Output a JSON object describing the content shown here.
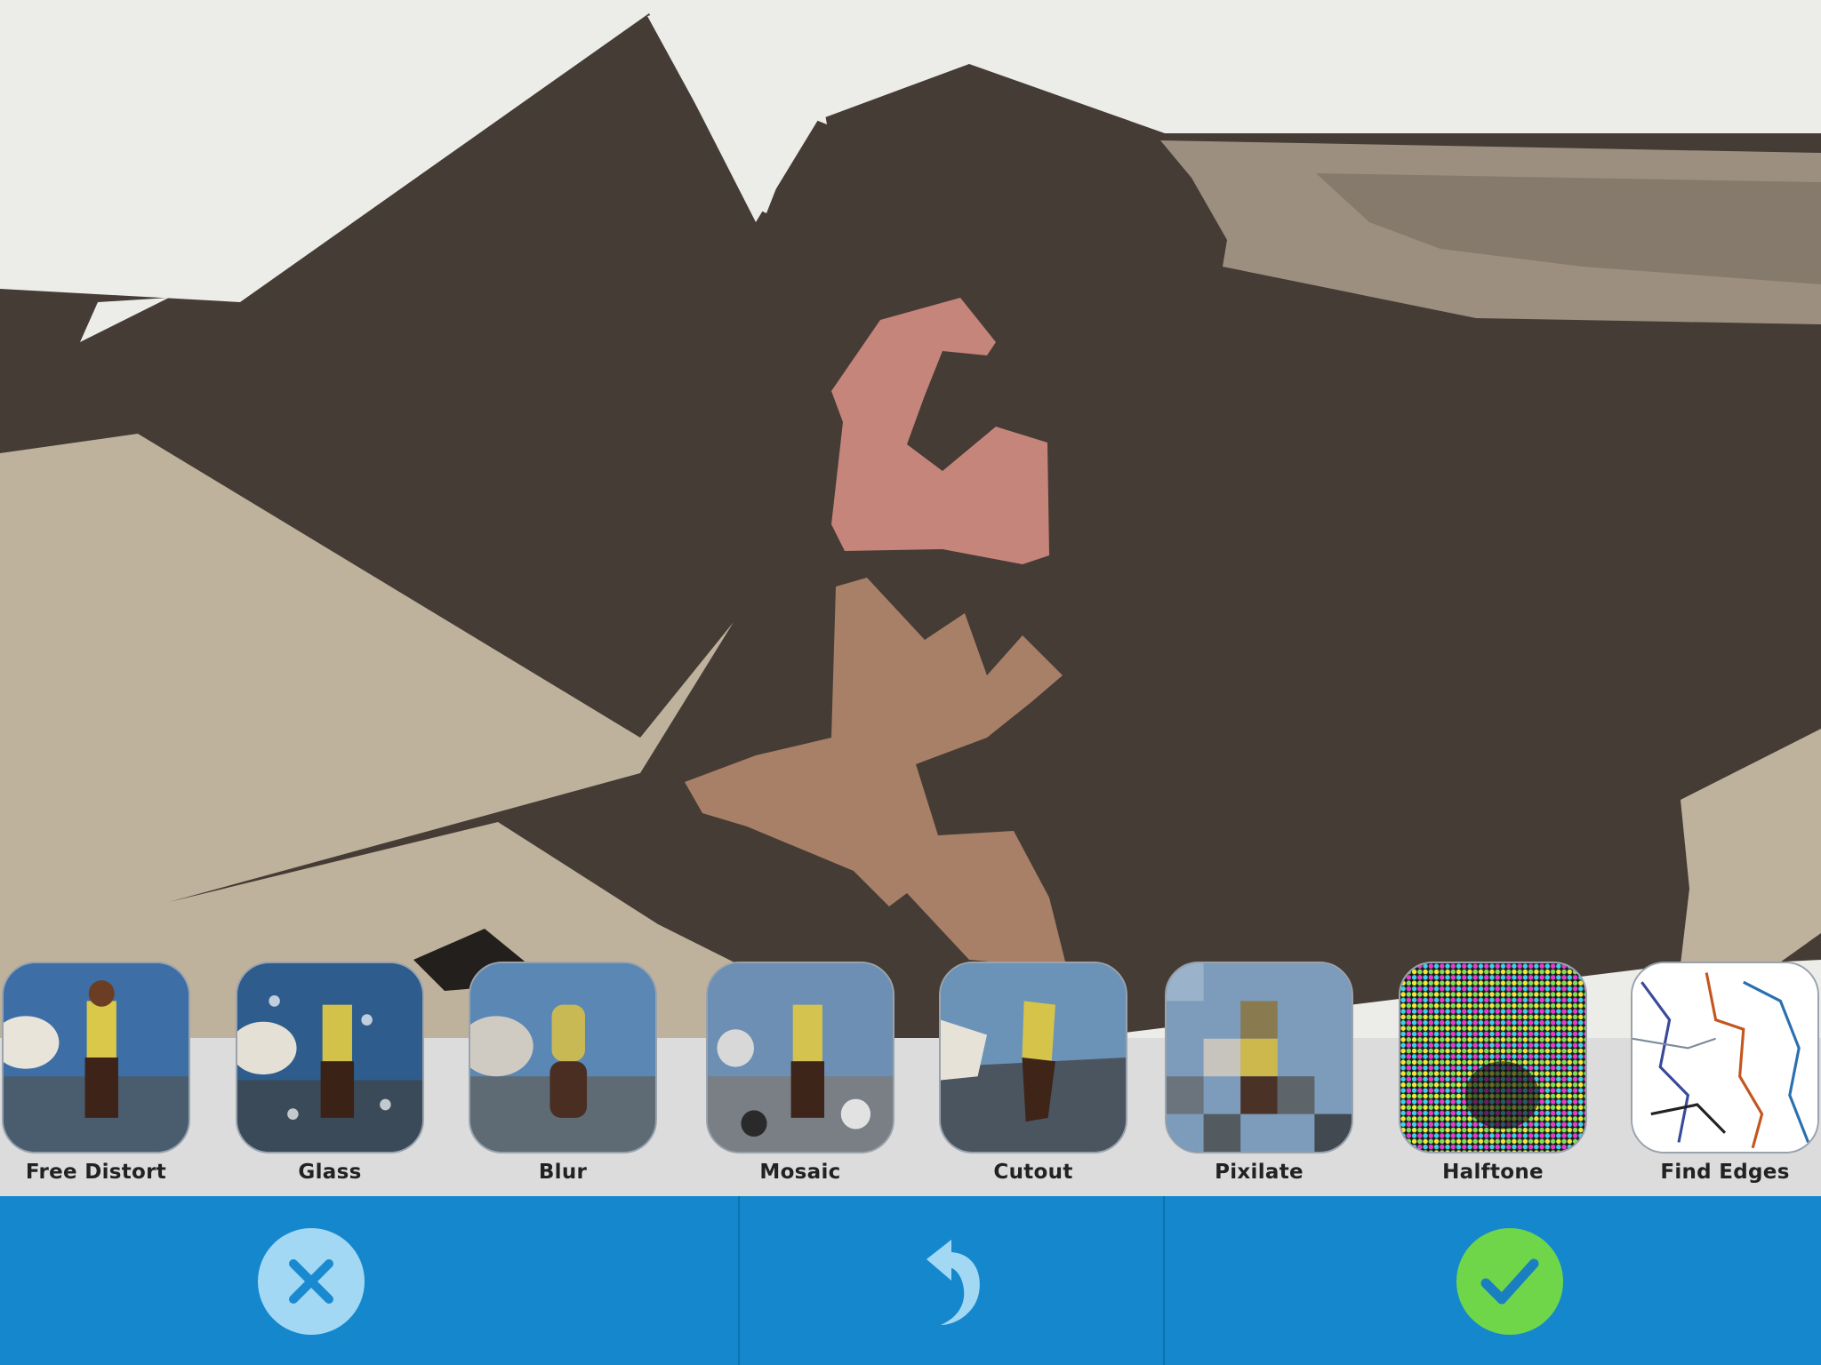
{
  "editor": {
    "canvas": "cutout-preview",
    "colors": {
      "background": "#ecece8",
      "dark_region": "#443c35",
      "tan_region": "#bfb29c",
      "light_tan_region": "#9c8f80",
      "pink_region": "#c5857a",
      "brown_region": "#a88068"
    }
  },
  "filters": [
    {
      "label": "Free Distort",
      "style": "photo"
    },
    {
      "label": "Glass",
      "style": "glass"
    },
    {
      "label": "Blur",
      "style": "blur"
    },
    {
      "label": "Mosaic",
      "style": "mosaic"
    },
    {
      "label": "Cutout",
      "style": "cutout"
    },
    {
      "label": "Pixilate",
      "style": "pixel"
    },
    {
      "label": "Halftone",
      "style": "halftone"
    },
    {
      "label": "Find Edges",
      "style": "edges"
    }
  ],
  "toolbar": {
    "cancel_icon": "close-x-icon",
    "undo_icon": "undo-arrow-icon",
    "confirm_icon": "checkmark-icon",
    "colors": {
      "bar": "#1588cd",
      "cancel_circle": "#a3d8f4",
      "cancel_x": "#1a8ad0",
      "undo_arrow": "#a3d8f4",
      "confirm_circle": "#6fd64a",
      "confirm_check": "#1a7fc0"
    }
  }
}
